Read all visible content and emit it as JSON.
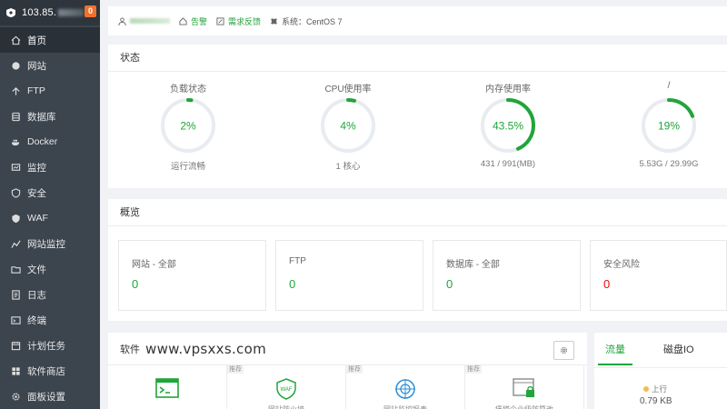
{
  "sidebar": {
    "ip": "103.85.",
    "badge": "0",
    "items": [
      {
        "label": "首页",
        "icon": "home-icon",
        "active": true
      },
      {
        "label": "网站",
        "icon": "globe-icon"
      },
      {
        "label": "FTP",
        "icon": "ftp-icon"
      },
      {
        "label": "数据库",
        "icon": "database-icon"
      },
      {
        "label": "Docker",
        "icon": "docker-icon"
      },
      {
        "label": "监控",
        "icon": "monitor-icon"
      },
      {
        "label": "安全",
        "icon": "shield-icon"
      },
      {
        "label": "WAF",
        "icon": "waf-shield-icon"
      },
      {
        "label": "网站监控",
        "icon": "chart-icon"
      },
      {
        "label": "文件",
        "icon": "folder-icon"
      },
      {
        "label": "日志",
        "icon": "log-icon"
      },
      {
        "label": "终端",
        "icon": "terminal-icon"
      },
      {
        "label": "计划任务",
        "icon": "clock-icon"
      },
      {
        "label": "软件商店",
        "icon": "store-icon"
      },
      {
        "label": "面板设置",
        "icon": "gear-icon"
      }
    ]
  },
  "topbar": {
    "notice": "告警",
    "feedback": "需求反馈",
    "system": "系统：CentOS 7"
  },
  "status": {
    "title": "状态",
    "gauges": [
      {
        "title": "负载状态",
        "value": "2%",
        "percent": 2,
        "sub": "运行流畅"
      },
      {
        "title": "CPU使用率",
        "value": "4%",
        "percent": 4,
        "sub": "1 核心"
      },
      {
        "title": "内存使用率",
        "value": "43.5%",
        "percent": 43.5,
        "sub": "431 / 991(MB)"
      },
      {
        "title": "/",
        "value": "19%",
        "percent": 19,
        "sub": "5.53G / 29.99G"
      }
    ],
    "color": "#20a53a"
  },
  "overview": {
    "title": "概览",
    "cards": [
      {
        "label": "网站 - 全部",
        "value": "0"
      },
      {
        "label": "FTP",
        "value": "0"
      },
      {
        "label": "数据库 - 全部",
        "value": "0"
      },
      {
        "label": "安全风险",
        "value": "0",
        "danger": true
      }
    ]
  },
  "software": {
    "title": "软件",
    "watermark": "www.vpsxxs.com",
    "tiles": [
      {
        "tag": "",
        "name": "",
        "icon": "terminal-window-icon"
      },
      {
        "tag": "推荐",
        "name": "网站防火墙",
        "icon": "waf-icon"
      },
      {
        "tag": "推荐",
        "name": "网站监控报表",
        "icon": "target-icon"
      },
      {
        "tag": "推荐",
        "name": "堡塔企业级防篡改",
        "icon": "lock-window-icon"
      }
    ]
  },
  "traffic": {
    "tabs": [
      "流量",
      "磁盘IO"
    ],
    "up_label": "上行",
    "up_value": "0.79 KB"
  }
}
